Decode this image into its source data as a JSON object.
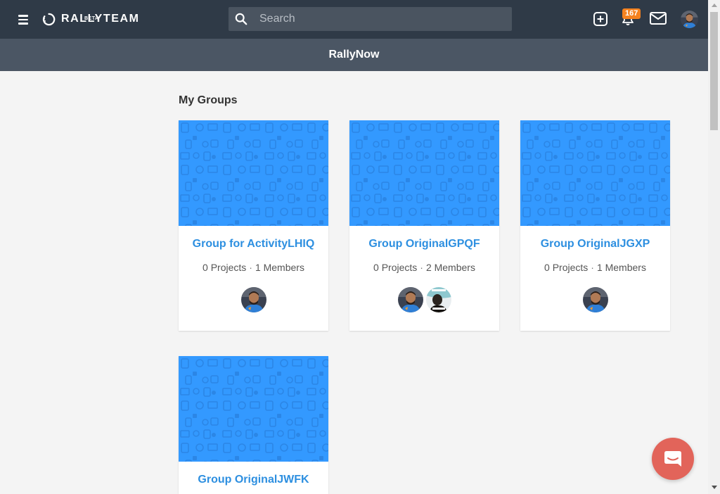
{
  "app": {
    "logo_text": "RALLYTEAM",
    "logo_beta": "BETA"
  },
  "search": {
    "placeholder": "Search",
    "value": ""
  },
  "notifications": {
    "count": "167"
  },
  "subheader": {
    "title": "RallyNow"
  },
  "section": {
    "title": "My Groups"
  },
  "groups": [
    {
      "name": "Group for ActivityLHIQ",
      "projects": "0 Projects",
      "members": "1 Members",
      "avatars": [
        "player"
      ]
    },
    {
      "name": "Group OriginalGPQF",
      "projects": "0 Projects",
      "members": "2 Members",
      "avatars": [
        "player",
        "meme"
      ]
    },
    {
      "name": "Group OriginalJGXP",
      "projects": "0 Projects",
      "members": "1 Members",
      "avatars": [
        "player"
      ]
    },
    {
      "name": "Group OriginalJWFK",
      "projects": "",
      "members": "",
      "avatars": []
    }
  ],
  "meta_separator": "·",
  "colors": {
    "topbar": "#2f3a47",
    "subheader": "#4b5664",
    "cover_blue": "#3399ff",
    "link_blue": "#2d8fe0",
    "badge_orange": "#f5821f",
    "chat_red": "#e2645a"
  },
  "icons": {
    "menu": "hamburger-icon",
    "search": "search-icon",
    "add": "plus-square-icon",
    "notifications": "bell-icon",
    "messages": "envelope-icon",
    "chat": "chat-bubble-icon"
  }
}
